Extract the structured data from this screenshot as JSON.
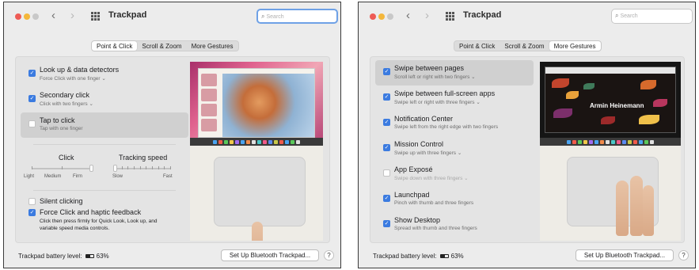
{
  "left": {
    "title": "Trackpad",
    "search_placeholder": "Search",
    "tabs": [
      "Point & Click",
      "Scroll & Zoom",
      "More Gestures"
    ],
    "options": [
      {
        "label": "Look up & data detectors",
        "sub": "Force Click with one finger ⌄"
      },
      {
        "label": "Secondary click",
        "sub": "Click with two fingers ⌄"
      },
      {
        "label": "Tap to click",
        "sub": "Tap with one finger"
      }
    ],
    "click_slider": {
      "title": "Click",
      "labels": [
        "Light",
        "Medium",
        "Firm"
      ],
      "value": 1.0
    },
    "tracking_slider": {
      "title": "Tracking speed",
      "labels": [
        "Slow",
        "Fast"
      ],
      "value": 0.0
    },
    "silent_clicking": "Silent clicking",
    "force_click": {
      "label": "Force Click and haptic feedback",
      "desc": "Click then press firmly for Quick Look, Look up, and variable speed media controls."
    },
    "battery_label": "Trackpad battery level:",
    "battery_pct": "63%",
    "setup_button": "Set Up Bluetooth Trackpad...",
    "help": "?"
  },
  "right": {
    "title": "Trackpad",
    "search_placeholder": "Search",
    "tabs": [
      "Point & Click",
      "Scroll & Zoom",
      "More Gestures"
    ],
    "options": [
      {
        "label": "Swipe between pages",
        "sub": "Scroll left or right with two fingers ⌄"
      },
      {
        "label": "Swipe between full-screen apps",
        "sub": "Swipe left or right with three fingers ⌄"
      },
      {
        "label": "Notification Center",
        "sub": "Swipe left from the right edge with two fingers"
      },
      {
        "label": "Mission Control",
        "sub": "Swipe up with three fingers ⌄"
      },
      {
        "label": "App Exposé",
        "sub": "Swipe down with three fingers ⌄"
      },
      {
        "label": "Launchpad",
        "sub": "Pinch with thumb and three fingers"
      },
      {
        "label": "Show Desktop",
        "sub": "Spread with thumb and three fingers"
      }
    ],
    "preview_caption": "Armin Heinemann",
    "battery_label": "Trackpad battery level:",
    "battery_pct": "63%",
    "setup_button": "Set Up Bluetooth Trackpad...",
    "help": "?"
  },
  "icons": {
    "back": "chevron-left-icon",
    "forward": "chevron-right-icon",
    "grid": "grid-icon",
    "search": "search-icon",
    "check": "checkmark-icon"
  },
  "colors": {
    "accent": "#3b7be0",
    "close": "#ee5b55",
    "minimize": "#f4b73b",
    "search_focus": "#6ea1e6"
  }
}
